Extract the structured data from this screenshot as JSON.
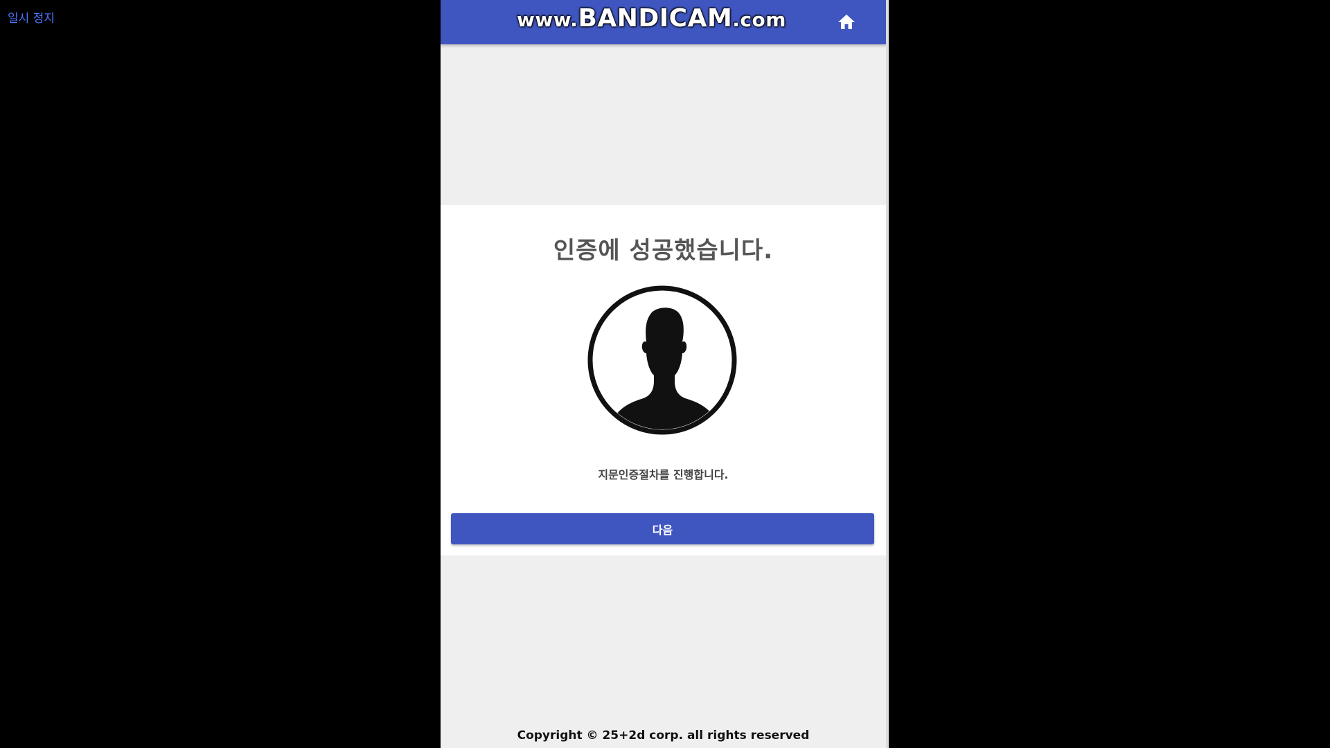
{
  "player": {
    "status_label": "일시 정지"
  },
  "header": {
    "watermark_prefix": "www.",
    "watermark_brand": "BANDICAM",
    "watermark_suffix": ".com",
    "home_icon": "home-icon",
    "background_color": "#3f56c0"
  },
  "card": {
    "title": "인증에 성공했습니다.",
    "avatar_icon": "user-silhouette-icon",
    "description": "지문인증절차를 진행합니다.",
    "next_button_label": "다음"
  },
  "footer": {
    "copyright": "Copyright © 25+2d corp. all rights reserved"
  },
  "colors": {
    "accent": "#3f56c0",
    "page_background": "#efefef",
    "card_background": "#ffffff",
    "player_status": "#4a74ff"
  }
}
